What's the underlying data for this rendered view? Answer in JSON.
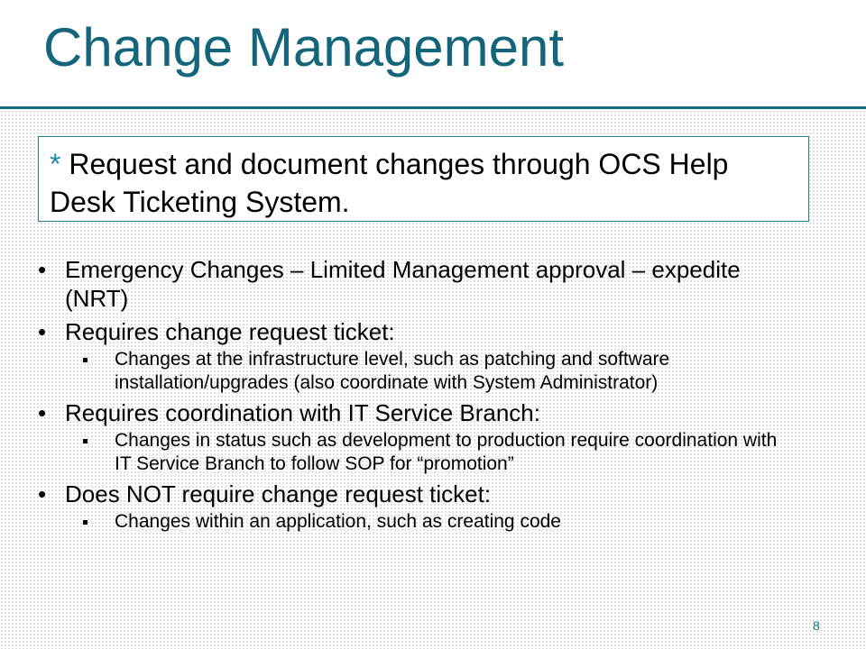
{
  "slide": {
    "title": "Change Management",
    "callout": {
      "star": "*",
      "text": "Request and document changes through OCS Help Desk Ticketing System."
    },
    "bullets": [
      {
        "text": "Emergency Changes – Limited Management approval – expedite (NRT)",
        "sub": []
      },
      {
        "text": "Requires change request ticket:",
        "sub": [
          "Changes at the infrastructure level, such as patching and software installation/upgrades (also coordinate with System Administrator)"
        ]
      },
      {
        "text": "Requires coordination with IT Service Branch:",
        "sub": [
          "Changes in status such as development to production require coordination with IT Service Branch to follow SOP for “promotion”"
        ]
      },
      {
        "text": "Does NOT require change request ticket:",
        "sub": [
          "Changes within an application, such as creating code"
        ]
      }
    ],
    "bullet_glyph": "•",
    "page_number": "8",
    "colors": {
      "title": "#13657a",
      "rule": "#156b7f",
      "callout_border": "#2a7d8f",
      "star": "#1b8aa3"
    }
  }
}
